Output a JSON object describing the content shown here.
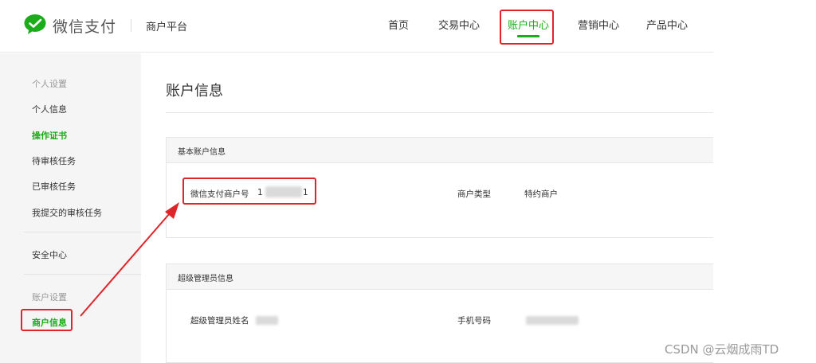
{
  "header": {
    "brand": "微信支付",
    "platform": "商户平台",
    "nav": [
      {
        "label": "首页"
      },
      {
        "label": "交易中心"
      },
      {
        "label": "账户中心"
      },
      {
        "label": "营销中心"
      },
      {
        "label": "产品中心"
      }
    ],
    "active_nav": "账户中心"
  },
  "sidebar": {
    "groups": [
      {
        "title": "个人设置",
        "items": [
          "个人信息",
          "操作证书",
          "待审核任务",
          "已审核任务",
          "我提交的审核任务"
        ]
      },
      {
        "title": "",
        "items": [
          "安全中心"
        ]
      },
      {
        "title": "账户设置",
        "items": [
          "商户信息"
        ]
      }
    ],
    "active_items": [
      "操作证书",
      "商户信息"
    ]
  },
  "main": {
    "title": "账户信息",
    "basic_panel": {
      "title": "基本账户信息",
      "merchant_id_label": "微信支付商户号",
      "merchant_id_prefix": "1",
      "merchant_id_suffix": "1",
      "merchant_type_label": "商户类型",
      "merchant_type_value": "特约商户"
    },
    "admin_panel": {
      "title": "超级管理员信息",
      "admin_name_label": "超级管理员姓名",
      "phone_label": "手机号码"
    }
  },
  "watermark": "CSDN @云烟成雨TD",
  "colors": {
    "accent": "#1aad19",
    "annotation": "#e0242a"
  },
  "icons": {
    "logo": "wechat-pay-logo-icon"
  }
}
